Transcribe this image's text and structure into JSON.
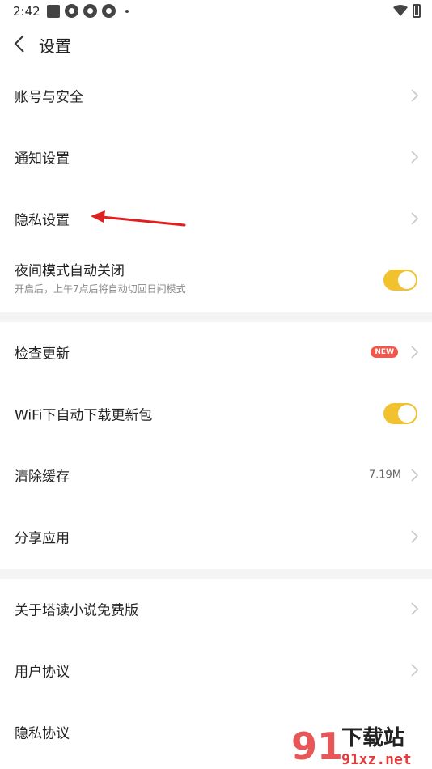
{
  "status_bar": {
    "time": "2:42"
  },
  "header": {
    "title": "设置"
  },
  "sections": [
    {
      "items": [
        {
          "label": "账号与安全",
          "type": "link"
        },
        {
          "label": "通知设置",
          "type": "link"
        },
        {
          "label": "隐私设置",
          "type": "link"
        },
        {
          "label": "夜间模式自动关闭",
          "subtitle": "开启后，上午7点后将自动切回日间模式",
          "type": "toggle",
          "on": true
        }
      ]
    },
    {
      "items": [
        {
          "label": "检查更新",
          "type": "link",
          "badge": "NEW"
        },
        {
          "label": "WiFi下自动下载更新包",
          "type": "toggle",
          "on": true
        },
        {
          "label": "清除缓存",
          "type": "link",
          "value": "7.19M"
        },
        {
          "label": "分享应用",
          "type": "link"
        }
      ]
    },
    {
      "items": [
        {
          "label": "关于塔读小说免费版",
          "type": "link"
        },
        {
          "label": "用户协议",
          "type": "link"
        },
        {
          "label": "隐私协议",
          "type": "link"
        }
      ]
    }
  ],
  "colors": {
    "toggle_on": "#f2c22e",
    "badge": "#f0584b",
    "annotation_arrow": "#e02020",
    "divider": "#f4f4f4"
  },
  "watermark": {
    "logo": "91",
    "title": "下载站",
    "url": "91xz.net"
  }
}
